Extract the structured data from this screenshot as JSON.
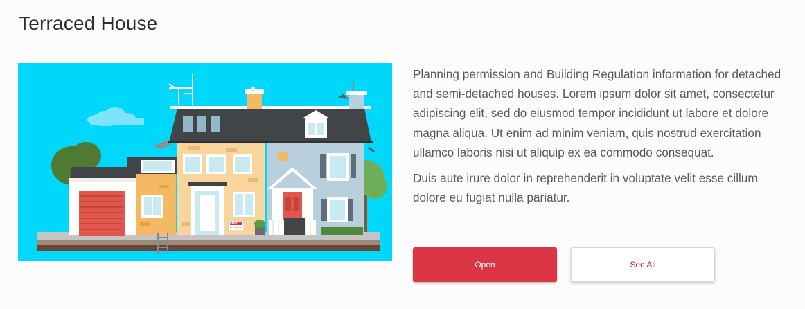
{
  "header": {
    "title": "Terraced House"
  },
  "hero": {
    "sign_text": "SOLD",
    "sign_subtext": "BY TERRACE"
  },
  "description": {
    "paragraphs": [
      "Planning permission and Building Regulation information for detached and semi-detached houses. Lorem ipsum dolor sit amet, consectetur adipiscing elit, sed do eiusmod tempor incididunt ut labore et dolore magna aliqua. Ut enim ad minim veniam, quis nostrud exercitation ullamco laboris nisi ut aliquip ex ea commodo consequat.",
      "Duis aute irure dolor in reprehenderit in voluptate velit esse cillum dolore eu fugiat nulla pariatur."
    ]
  },
  "actions": {
    "open_label": "Open",
    "see_all_label": "See All"
  },
  "colors": {
    "accent": "#dc3545",
    "sky": "#00d8fb",
    "roof": "#424548",
    "tan_house": "#f8d59c",
    "blue_house": "#b9cfdc",
    "garage_door": "#e0584b"
  }
}
